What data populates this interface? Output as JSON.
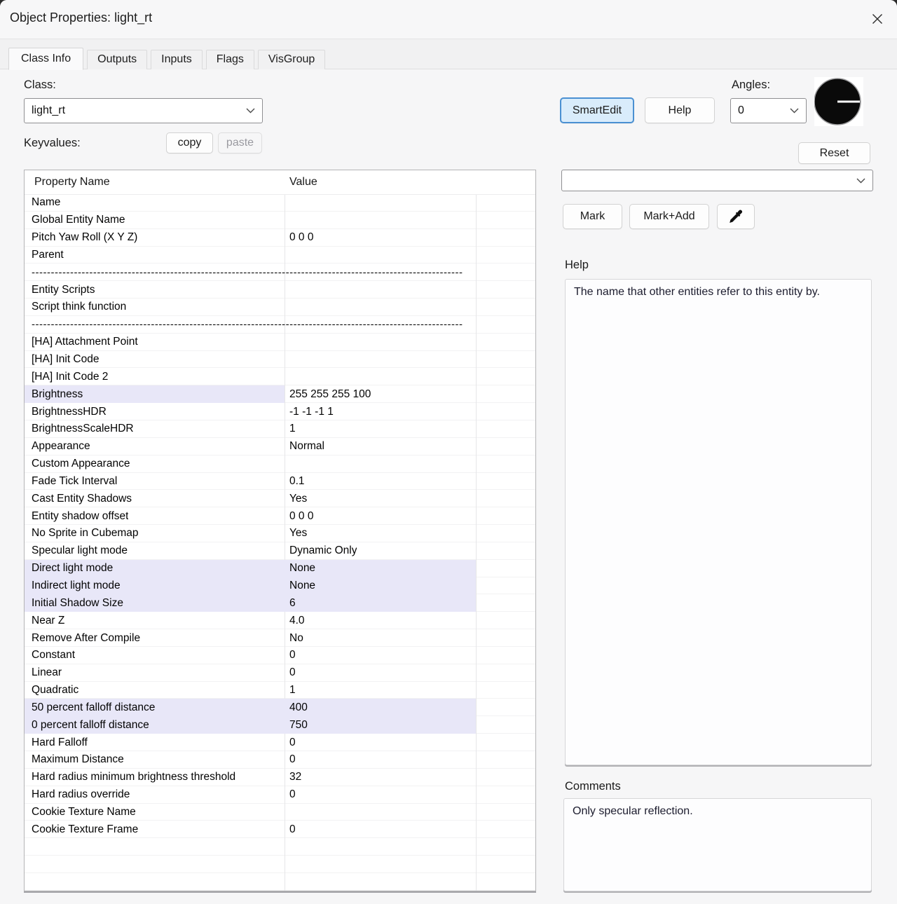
{
  "window": {
    "title": "Object Properties: light_rt"
  },
  "icons": [
    "close-icon",
    "chevron-down-icon",
    "eyedropper-icon",
    "angle-dial-icon"
  ],
  "tabs": [
    {
      "label": "Class Info",
      "active": true
    },
    {
      "label": "Outputs",
      "active": false
    },
    {
      "label": "Inputs",
      "active": false
    },
    {
      "label": "Flags",
      "active": false
    },
    {
      "label": "VisGroup",
      "active": false
    }
  ],
  "class_section": {
    "class_label": "Class:",
    "class_value": "light_rt",
    "smartedit_label": "SmartEdit",
    "help_label": "Help",
    "angles_label": "Angles:",
    "angles_value": "0",
    "keyvalues_label": "Keyvalues:",
    "copy_label": "copy",
    "paste_label": "paste",
    "reset_label": "Reset"
  },
  "search_combo": {
    "value": ""
  },
  "actions": {
    "mark_label": "Mark",
    "mark_add_label": "Mark+Add"
  },
  "help_panel": {
    "label": "Help",
    "text": "The name that other entities refer to this entity by."
  },
  "comments_panel": {
    "label": "Comments",
    "text": "Only specular reflection."
  },
  "colors": {
    "row_highlight": "#e8e7f8",
    "smartedit_bg": "#d9ecfb",
    "smartedit_border": "#4a90d2",
    "angle_dial": "#0a0a0a"
  },
  "table": {
    "headers": [
      "Property Name",
      "Value"
    ],
    "separator_dashes": "--------------------------------------------------------------------------------------------------------------------------------------------",
    "rows": [
      {
        "name": "Name",
        "value": "",
        "hl": "none"
      },
      {
        "name": "Global Entity Name",
        "value": "",
        "hl": "none"
      },
      {
        "name": "Pitch Yaw Roll (X Y Z)",
        "value": "0 0 0",
        "hl": "none"
      },
      {
        "name": "Parent",
        "value": "",
        "hl": "none"
      },
      {
        "sep": true
      },
      {
        "name": "Entity Scripts",
        "value": "",
        "hl": "none"
      },
      {
        "name": "Script think function",
        "value": "",
        "hl": "none"
      },
      {
        "sep": true
      },
      {
        "name": "[HA] Attachment Point",
        "value": "",
        "hl": "none"
      },
      {
        "name": "[HA] Init Code",
        "value": "",
        "hl": "none"
      },
      {
        "name": "[HA] Init Code 2",
        "value": "",
        "hl": "none"
      },
      {
        "name": "Brightness",
        "value": "255 255 255 100",
        "hl": "name"
      },
      {
        "name": "BrightnessHDR",
        "value": "-1 -1 -1 1",
        "hl": "none"
      },
      {
        "name": "BrightnessScaleHDR",
        "value": "1",
        "hl": "none"
      },
      {
        "name": "Appearance",
        "value": "Normal",
        "hl": "none"
      },
      {
        "name": "Custom Appearance",
        "value": "",
        "hl": "none"
      },
      {
        "name": "Fade Tick Interval",
        "value": "0.1",
        "hl": "none"
      },
      {
        "name": "Cast Entity Shadows",
        "value": "Yes",
        "hl": "none"
      },
      {
        "name": "Entity shadow offset",
        "value": "0 0 0",
        "hl": "none"
      },
      {
        "name": "No Sprite in Cubemap",
        "value": "Yes",
        "hl": "none"
      },
      {
        "name": "Specular light mode",
        "value": "Dynamic Only",
        "hl": "none"
      },
      {
        "name": "Direct light mode",
        "value": "None",
        "hl": "row"
      },
      {
        "name": "Indirect light mode",
        "value": "None",
        "hl": "row"
      },
      {
        "name": "Initial Shadow Size",
        "value": "6",
        "hl": "row"
      },
      {
        "name": "Near Z",
        "value": "4.0",
        "hl": "none"
      },
      {
        "name": "Remove After Compile",
        "value": "No",
        "hl": "none"
      },
      {
        "name": "Constant",
        "value": "0",
        "hl": "none"
      },
      {
        "name": "Linear",
        "value": "0",
        "hl": "none"
      },
      {
        "name": "Quadratic",
        "value": "1",
        "hl": "none"
      },
      {
        "name": "50 percent falloff distance",
        "value": "400",
        "hl": "row"
      },
      {
        "name": "0 percent falloff distance",
        "value": "750",
        "hl": "row"
      },
      {
        "name": "Hard Falloff",
        "value": "0",
        "hl": "none"
      },
      {
        "name": "Maximum Distance",
        "value": "0",
        "hl": "none"
      },
      {
        "name": "Hard radius minimum brightness threshold",
        "value": "32",
        "hl": "none"
      },
      {
        "name": "Hard radius override",
        "value": "0",
        "hl": "none"
      },
      {
        "name": "Cookie Texture Name",
        "value": "",
        "hl": "none"
      },
      {
        "name": "Cookie Texture Frame",
        "value": "0",
        "hl": "none"
      },
      {
        "name": "",
        "value": "",
        "hl": "none"
      },
      {
        "name": "",
        "value": "",
        "hl": "none"
      },
      {
        "name": "",
        "value": "",
        "hl": "none"
      }
    ]
  }
}
